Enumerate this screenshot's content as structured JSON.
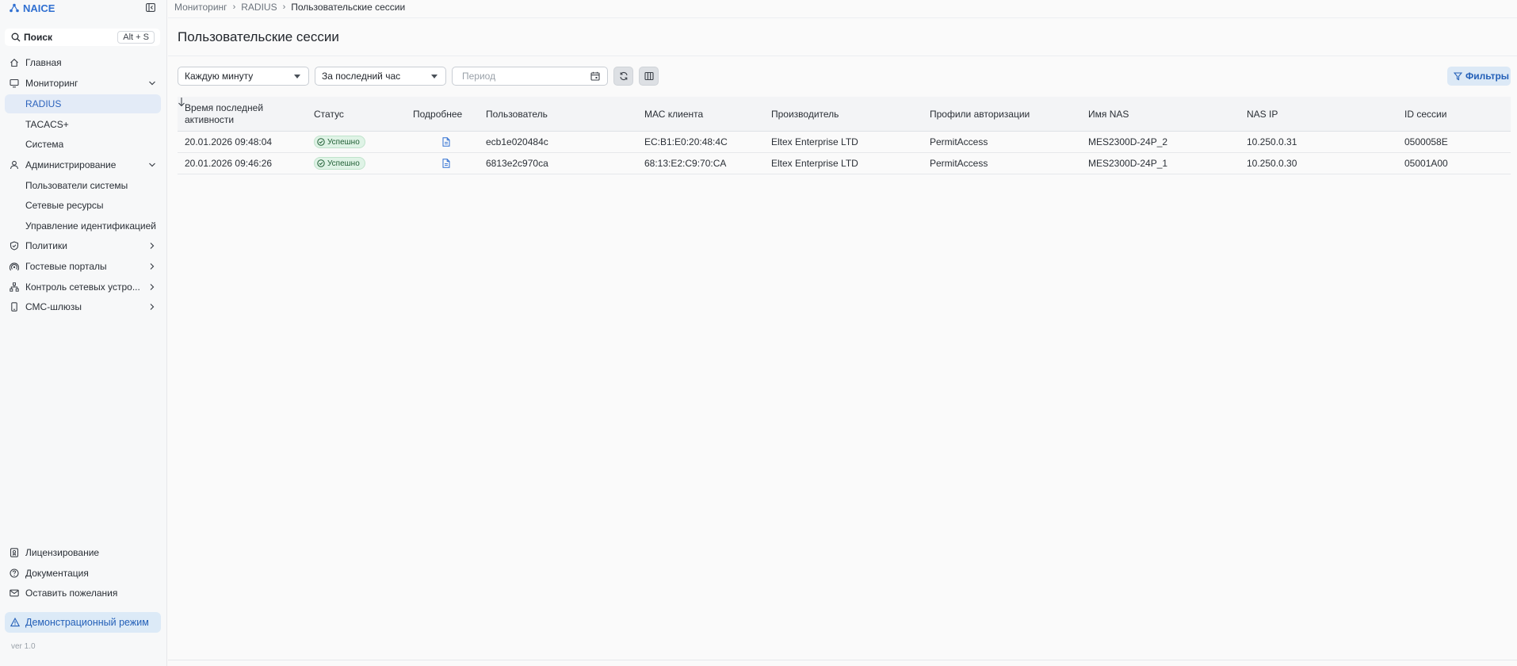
{
  "app": {
    "name": "NAICE",
    "brand_color": "#2f6fd1",
    "version": "ver 1.0"
  },
  "search": {
    "placeholder": "Поиск",
    "shortcut": "Alt + S"
  },
  "sidebar": {
    "items": [
      {
        "label": "Главная",
        "icon": "home-icon"
      },
      {
        "label": "Мониторинг",
        "icon": "monitor-icon",
        "expanded": true
      },
      {
        "label": "RADIUS",
        "active": true
      },
      {
        "label": "TACACS+"
      },
      {
        "label": "Система"
      },
      {
        "label": "Администрирование",
        "icon": "user-icon",
        "expanded": true
      },
      {
        "label": "Пользователи системы"
      },
      {
        "label": "Сетевые ресурсы"
      },
      {
        "label": "Управление идентификацией"
      },
      {
        "label": "Политики",
        "icon": "shield-check-icon"
      },
      {
        "label": "Гостевые порталы",
        "icon": "broadcast-icon"
      },
      {
        "label": "Контроль сетевых устро...",
        "icon": "network-icon"
      },
      {
        "label": "СМС-шлюзы",
        "icon": "phone-icon"
      }
    ],
    "bottom": [
      {
        "label": "Лицензирование",
        "icon": "license-icon"
      },
      {
        "label": "Документация",
        "icon": "help-icon"
      },
      {
        "label": "Оставить пожелания",
        "icon": "mail-icon"
      }
    ],
    "demo_mode": "Демонстрационный режим"
  },
  "breadcrumb": {
    "items": [
      "Мониторинг",
      "RADIUS"
    ],
    "current": "Пользовательские сессии"
  },
  "page": {
    "title": "Пользовательские сессии"
  },
  "toolbar": {
    "refresh_interval": "Каждую минуту",
    "time_range": "За последний час",
    "period_placeholder": "Период",
    "filters_label": "Фильтры",
    "accent": "#2460b8"
  },
  "table": {
    "columns": [
      "Время последней активности",
      "Статус",
      "Подробнее",
      "Пользователь",
      "МАС клиента",
      "Производитель",
      "Профили авторизации",
      "Имя NAS",
      "NAS IP",
      "ID сессии"
    ],
    "rows": [
      {
        "time": "20.01.2026 09:48:04",
        "status": "Успешно",
        "user": "ecb1e020484c",
        "mac": "EC:B1:E0:20:48:4C",
        "vendor": "Eltex Enterprise LTD",
        "profile": "PermitAccess",
        "nas_name": "MES2300D-24P_2",
        "nas_ip": "10.250.0.31",
        "session_id": "0500058E"
      },
      {
        "time": "20.01.2026 09:46:26",
        "status": "Успешно",
        "user": "6813e2c970ca",
        "mac": "68:13:E2:C9:70:CA",
        "vendor": "Eltex Enterprise LTD",
        "profile": "PermitAccess",
        "nas_name": "MES2300D-24P_1",
        "nas_ip": "10.250.0.30",
        "session_id": "05001A00"
      }
    ],
    "status_color": "#1f5e34"
  }
}
